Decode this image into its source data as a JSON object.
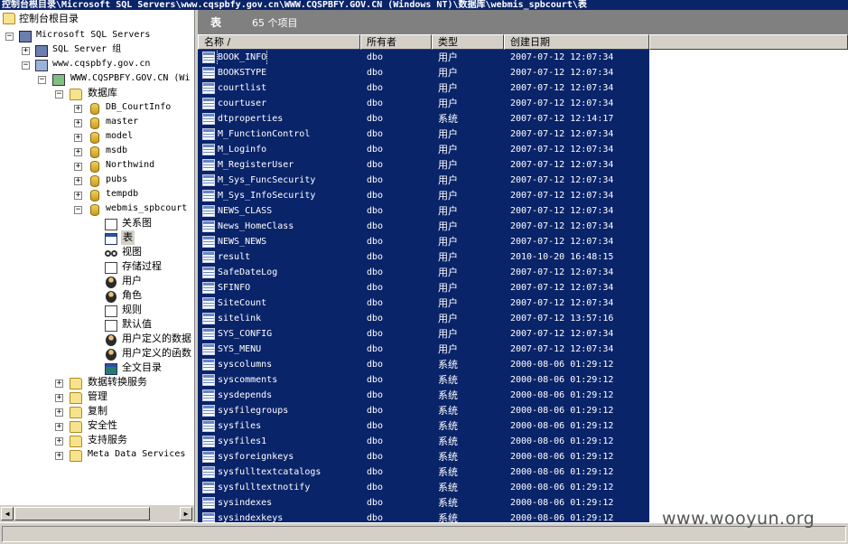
{
  "window": {
    "title": "控制台根目录\\Microsoft SQL Servers\\www.cqspbfy.gov.cn\\WWW.CQSPBFY.GOV.CN (Windows NT)\\数据库\\webmis_spbcourt\\表"
  },
  "tree": {
    "root": "控制台根目录",
    "sql_servers": "Microsoft SQL Servers",
    "server_group": "SQL Server 组",
    "server_host": "www.cqspbfy.gov.cn",
    "server_instance": "WWW.CQSPBFY.GOV.CN (Wi",
    "databases_folder": "数据库",
    "databases": [
      "DB_CourtInfo",
      "master",
      "model",
      "msdb",
      "Northwind",
      "pubs",
      "tempdb",
      "webmis_spbcourt"
    ],
    "db_children": [
      {
        "label": "关系图",
        "icon": "diagram-icon"
      },
      {
        "label": "表",
        "icon": "table-icon"
      },
      {
        "label": "视图",
        "icon": "view-glasses-icon"
      },
      {
        "label": "存储过程",
        "icon": "stored-procedure-icon"
      },
      {
        "label": "用户",
        "icon": "user-icon"
      },
      {
        "label": "角色",
        "icon": "role-icon"
      },
      {
        "label": "规则",
        "icon": "rule-icon"
      },
      {
        "label": "默认值",
        "icon": "default-icon"
      },
      {
        "label": "用户定义的数据",
        "icon": "user-defined-datatype-icon"
      },
      {
        "label": "用户定义的函数",
        "icon": "user-defined-function-icon"
      },
      {
        "label": "全文目录",
        "icon": "fulltext-catalog-icon"
      }
    ],
    "server_folders": [
      "数据转换服务",
      "管理",
      "复制",
      "安全性",
      "支持服务",
      "Meta Data Services"
    ]
  },
  "right_panel": {
    "title": "表",
    "count": "65 个项目",
    "columns": [
      "名称 /",
      "所有者",
      "类型",
      "创建日期"
    ]
  },
  "tables": [
    [
      "BOOK_INFO",
      "dbo",
      "用户",
      "2007-07-12 12:07:34"
    ],
    [
      "BOOKSTYPE",
      "dbo",
      "用户",
      "2007-07-12 12:07:34"
    ],
    [
      "courtlist",
      "dbo",
      "用户",
      "2007-07-12 12:07:34"
    ],
    [
      "courtuser",
      "dbo",
      "用户",
      "2007-07-12 12:07:34"
    ],
    [
      "dtproperties",
      "dbo",
      "系统",
      "2007-07-12 12:14:17"
    ],
    [
      "M_FunctionControl",
      "dbo",
      "用户",
      "2007-07-12 12:07:34"
    ],
    [
      "M_Loginfo",
      "dbo",
      "用户",
      "2007-07-12 12:07:34"
    ],
    [
      "M_RegisterUser",
      "dbo",
      "用户",
      "2007-07-12 12:07:34"
    ],
    [
      "M_Sys_FuncSecurity",
      "dbo",
      "用户",
      "2007-07-12 12:07:34"
    ],
    [
      "M_Sys_InfoSecurity",
      "dbo",
      "用户",
      "2007-07-12 12:07:34"
    ],
    [
      "NEWS_CLASS",
      "dbo",
      "用户",
      "2007-07-12 12:07:34"
    ],
    [
      "News_HomeClass",
      "dbo",
      "用户",
      "2007-07-12 12:07:34"
    ],
    [
      "NEWS_NEWS",
      "dbo",
      "用户",
      "2007-07-12 12:07:34"
    ],
    [
      "result",
      "dbo",
      "用户",
      "2010-10-20 16:48:15"
    ],
    [
      "SafeDateLog",
      "dbo",
      "用户",
      "2007-07-12 12:07:34"
    ],
    [
      "SFINFO",
      "dbo",
      "用户",
      "2007-07-12 12:07:34"
    ],
    [
      "SiteCount",
      "dbo",
      "用户",
      "2007-07-12 12:07:34"
    ],
    [
      "sitelink",
      "dbo",
      "用户",
      "2007-07-12 13:57:16"
    ],
    [
      "SYS_CONFIG",
      "dbo",
      "用户",
      "2007-07-12 12:07:34"
    ],
    [
      "SYS_MENU",
      "dbo",
      "用户",
      "2007-07-12 12:07:34"
    ],
    [
      "syscolumns",
      "dbo",
      "系统",
      "2000-08-06 01:29:12"
    ],
    [
      "syscomments",
      "dbo",
      "系统",
      "2000-08-06 01:29:12"
    ],
    [
      "sysdepends",
      "dbo",
      "系统",
      "2000-08-06 01:29:12"
    ],
    [
      "sysfilegroups",
      "dbo",
      "系统",
      "2000-08-06 01:29:12"
    ],
    [
      "sysfiles",
      "dbo",
      "系统",
      "2000-08-06 01:29:12"
    ],
    [
      "sysfiles1",
      "dbo",
      "系统",
      "2000-08-06 01:29:12"
    ],
    [
      "sysforeignkeys",
      "dbo",
      "系统",
      "2000-08-06 01:29:12"
    ],
    [
      "sysfulltextcatalogs",
      "dbo",
      "系统",
      "2000-08-06 01:29:12"
    ],
    [
      "sysfulltextnotify",
      "dbo",
      "系统",
      "2000-08-06 01:29:12"
    ],
    [
      "sysindexes",
      "dbo",
      "系统",
      "2000-08-06 01:29:12"
    ],
    [
      "sysindexkeys",
      "dbo",
      "系统",
      "2000-08-06 01:29:12"
    ]
  ],
  "watermark": "www.wooyun.org",
  "colors": {
    "selection": "#0a246a",
    "titlebar": "#0a246a",
    "chrome": "#d4d0c8",
    "panel_header": "#808080"
  }
}
